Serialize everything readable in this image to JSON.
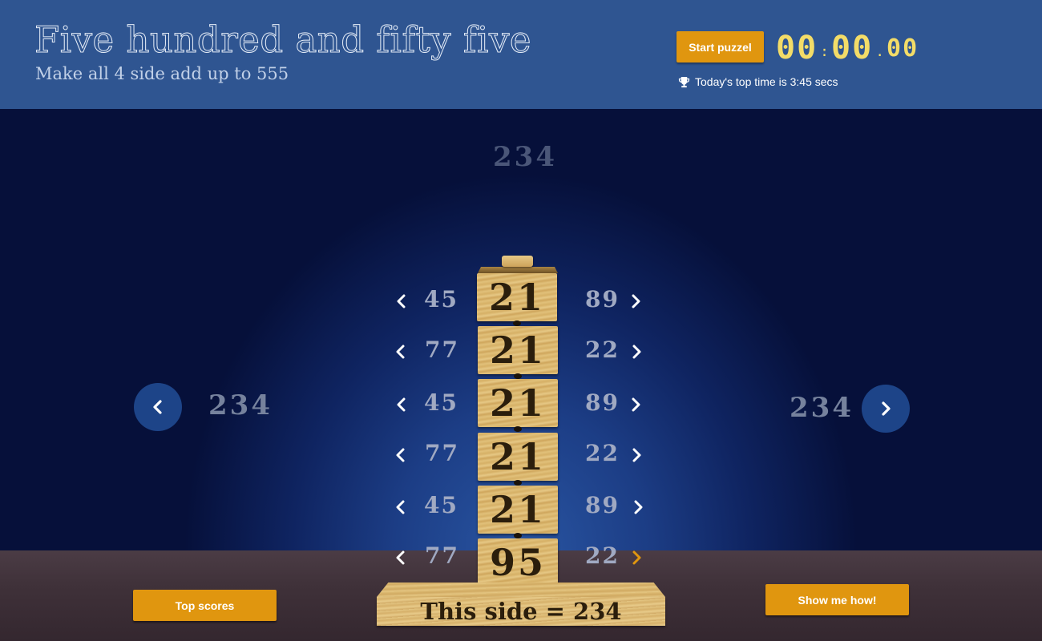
{
  "header": {
    "title": "Five hundred and fifty five",
    "subtitle": "Make all 4 side add up to 555",
    "start_label": "Start puzzel",
    "timer": {
      "minutes": "00",
      "seconds": "00",
      "hundredths": "00"
    },
    "top_time": "Today's top time is 3:45 secs"
  },
  "sides": {
    "top": "234",
    "left": "234",
    "right": "234"
  },
  "rows": [
    {
      "left": "45",
      "tile": "21",
      "right": "89"
    },
    {
      "left": "77",
      "tile": "21",
      "right": "22"
    },
    {
      "left": "45",
      "tile": "21",
      "right": "89"
    },
    {
      "left": "77",
      "tile": "21",
      "right": "22"
    },
    {
      "left": "45",
      "tile": "21",
      "right": "89"
    },
    {
      "left": "77",
      "tile": "95",
      "right": "22"
    }
  ],
  "base_label": "This side = 234",
  "buttons": {
    "top_scores": "Top scores",
    "show_me_how": "Show me how!"
  },
  "colors": {
    "accent": "#e0960f",
    "header": "#2f5591",
    "timer": "#f3dc68",
    "active_chevron": "#e0960f"
  },
  "icons": {
    "trophy": "trophy-icon",
    "left": "chevron-left-icon",
    "right": "chevron-right-icon"
  }
}
